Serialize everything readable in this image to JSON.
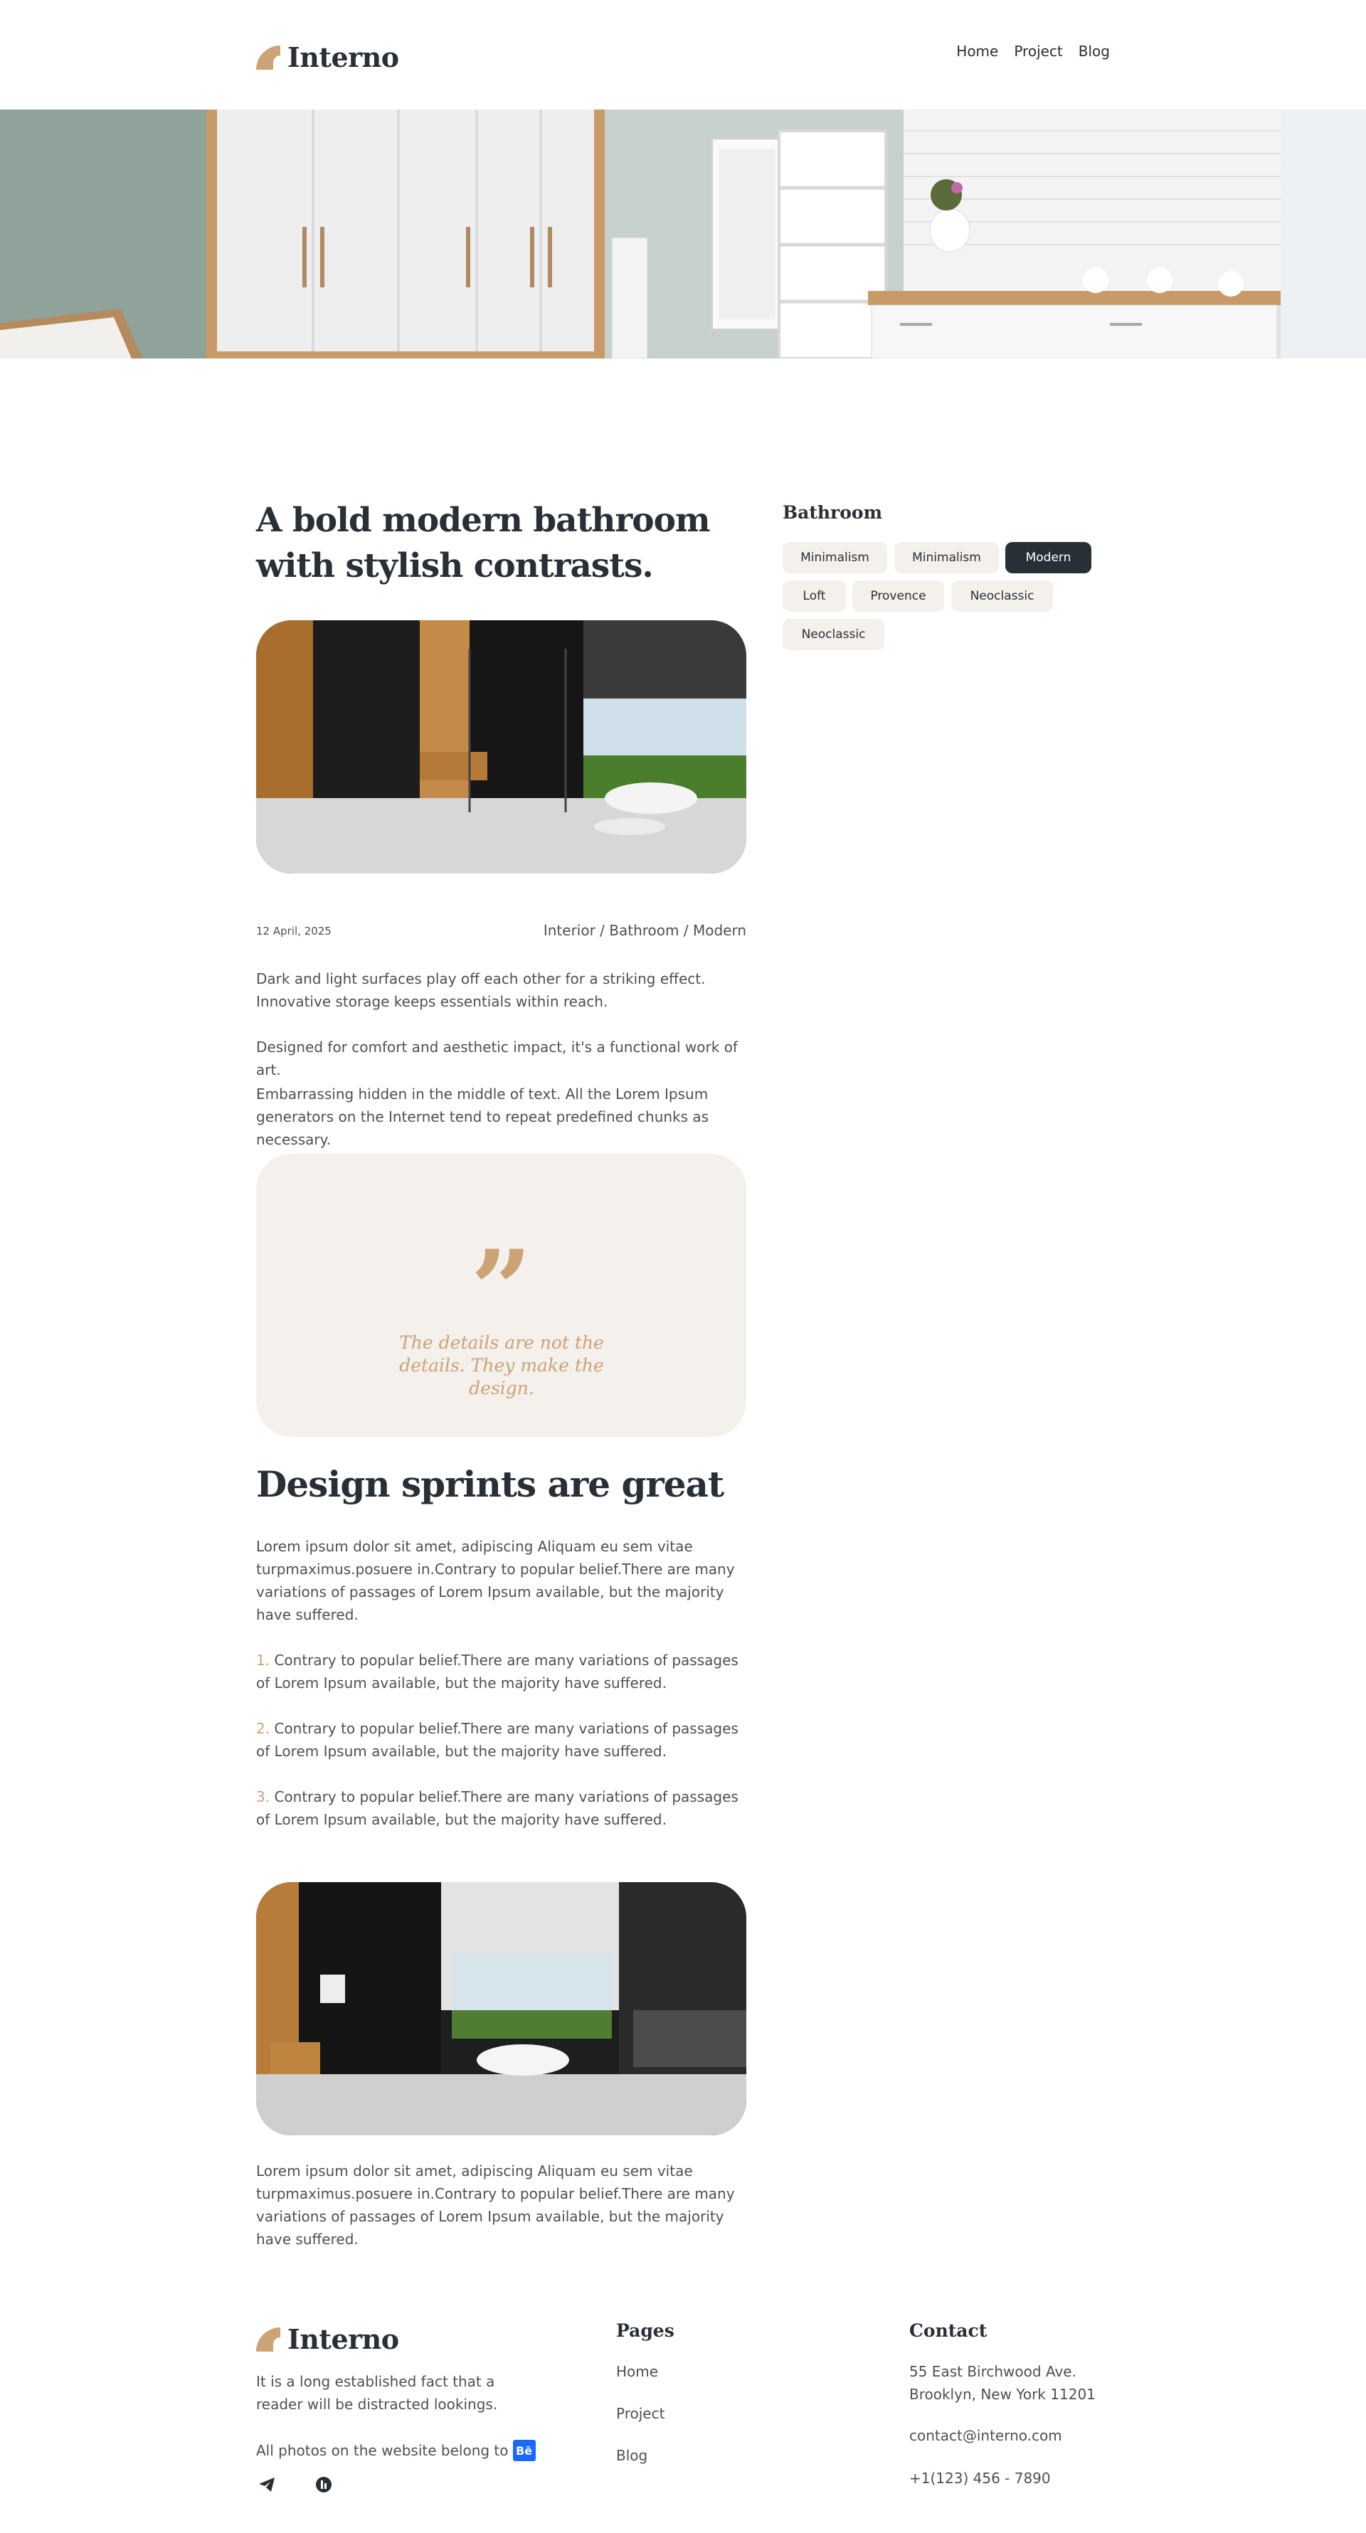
{
  "header": {
    "logo_text": "Interno",
    "nav": [
      "Home",
      "Project",
      "Blog"
    ]
  },
  "article": {
    "title": "A bold modern bathroom with stylish contrasts.",
    "date": "12 April, 2025",
    "breadcrumb": "Interior / Bathroom / Modern",
    "paragraphs": [
      "Dark and light surfaces play off each other for a striking effect. Innovative storage keeps essentials within reach.",
      "Designed for comfort and aesthetic impact, it's a functional work of art.",
      "Embarrassing hidden in the middle of text. All the Lorem Ipsum generators on the Internet tend to repeat predefined chunks as necessary."
    ],
    "quote_mark": "”",
    "quote": "The details are not the details. They make the design.",
    "section_title": "Design sprints are great",
    "section_intro": "Lorem ipsum dolor sit amet, adipiscing Aliquam eu sem vitae turpmaximus.posuere in.Contrary to popular belief.There are many variations of passages of Lorem Ipsum available, but the majority have suffered.",
    "list": [
      {
        "num": "1.",
        "text": " Contrary to popular belief.There are many variations of passages of Lorem Ipsum available, but the majority have suffered."
      },
      {
        "num": "2.",
        "text": " Contrary to popular belief.There are many variations of passages of Lorem Ipsum available, but the majority have suffered."
      },
      {
        "num": "3.",
        "text": " Contrary to popular belief.There are many variations of passages of Lorem Ipsum available, but the majority have suffered."
      }
    ],
    "closing": "Lorem ipsum dolor sit amet, adipiscing Aliquam eu sem vitae turpmaximus.posuere in.Contrary to popular belief.There are many variations of passages of Lorem Ipsum available, but the majority have suffered."
  },
  "sidebar": {
    "title": "Bathroom",
    "tags": [
      "Minimalism",
      "Minimalism",
      "Modern",
      "Loft",
      "Provence",
      "Neoclassic",
      "Neoclassic"
    ],
    "active_tag": "Modern"
  },
  "footer": {
    "logo_text": "Interno",
    "description": "It is a long established fact that a reader will be distracted lookings.",
    "photos_note": "All photos on the website belong to",
    "behance_label": "Bē",
    "pages_title": "Pages",
    "pages": [
      "Home",
      "Project",
      "Blog"
    ],
    "contact_title": "Contact",
    "address_line1": "55 East Birchwood Ave.",
    "address_line2": "Brooklyn, New York 11201",
    "email": "contact@interno.com",
    "phone": "+1(123) 456 - 7890"
  },
  "colors": {
    "accent": "#cda274",
    "dark": "#292f36",
    "beige": "#f4f0ec",
    "behance": "#1769ff"
  },
  "icons": [
    "logo-icon",
    "telegram-icon",
    "houzz-icon",
    "behance-icon"
  ]
}
